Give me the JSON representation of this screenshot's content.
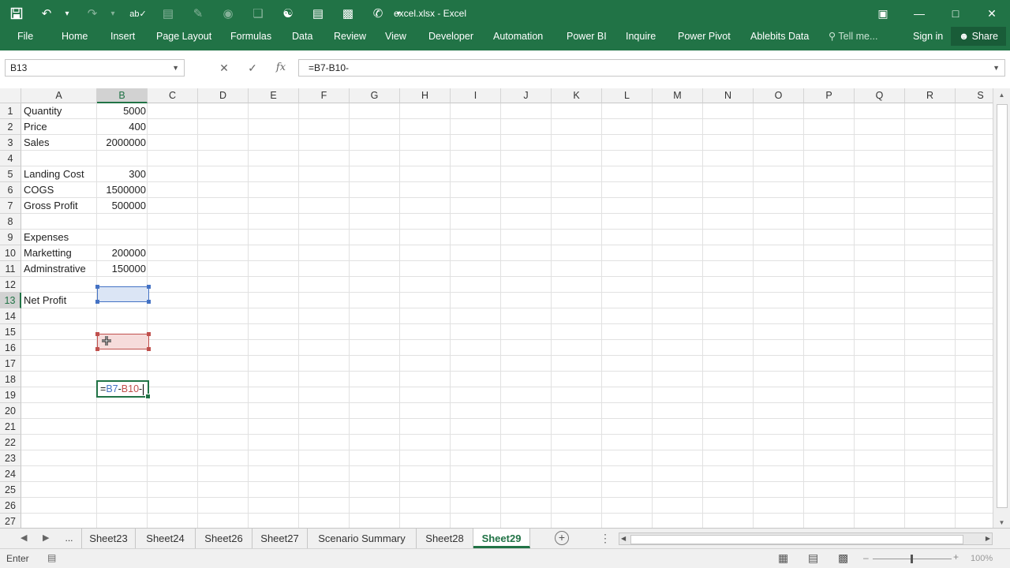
{
  "titlebar": {
    "title": "excel.xlsx - Excel",
    "qat": [
      "save-icon",
      "undo-icon",
      "redo-icon",
      "spelling-icon",
      "form-icon",
      "edit-icon",
      "camera-icon",
      "shapes-icon",
      "hierarchy-icon",
      "document-icon",
      "truck-icon",
      "phone-icon",
      "customize-icon"
    ]
  },
  "ribbon": {
    "tabs": [
      "File",
      "Home",
      "Insert",
      "Page Layout",
      "Formulas",
      "Data",
      "Review",
      "View",
      "Developer",
      "Automation",
      "Power BI",
      "Inquire",
      "Power Pivot",
      "Ablebits Data"
    ],
    "tell_me": "Tell me...",
    "sign_in": "Sign in",
    "share": "Share"
  },
  "formula_bar": {
    "name_box": "B13",
    "formula": "=B7-B10-"
  },
  "columns": [
    "A",
    "B",
    "C",
    "D",
    "E",
    "F",
    "G",
    "H",
    "I",
    "J",
    "K",
    "L",
    "M",
    "N",
    "O",
    "P",
    "Q",
    "R",
    "S"
  ],
  "rows": [
    "1",
    "2",
    "3",
    "4",
    "5",
    "6",
    "7",
    "8",
    "9",
    "10",
    "11",
    "12",
    "13",
    "14",
    "15",
    "16",
    "17",
    "18",
    "19",
    "20",
    "21",
    "22",
    "23",
    "24",
    "25",
    "26",
    "27"
  ],
  "cells": [
    {
      "row": 1,
      "a": "Quantity",
      "b": "5000"
    },
    {
      "row": 2,
      "a": "Price",
      "b": "400"
    },
    {
      "row": 3,
      "a": "Sales",
      "b": "2000000"
    },
    {
      "row": 5,
      "a": "Landing Cost",
      "b": "300"
    },
    {
      "row": 6,
      "a": "COGS",
      "b": "1500000"
    },
    {
      "row": 7,
      "a": "Gross Profit",
      "b": "500000"
    },
    {
      "row": 9,
      "a": "Expenses",
      "b": ""
    },
    {
      "row": 10,
      "a": "Marketting",
      "b": "200000"
    },
    {
      "row": 11,
      "a": "Adminstrative",
      "b": "150000"
    },
    {
      "row": 13,
      "a": "Net Profit",
      "b": ""
    }
  ],
  "edit_cell": {
    "prefix": "=",
    "ref1": "B7",
    "op1": "-",
    "ref2": "B10",
    "op2": "-"
  },
  "colors": {
    "accent": "#217346",
    "ref_blue": "#4472c4",
    "ref_red": "#c0504d"
  },
  "sheets": {
    "ellipsis": "...",
    "tabs": [
      "Sheet23",
      "Sheet24",
      "Sheet26",
      "Sheet27",
      "Scenario Summary",
      "Sheet28",
      "Sheet29"
    ],
    "active": "Sheet29"
  },
  "status": {
    "mode": "Enter",
    "zoom": "100%"
  }
}
